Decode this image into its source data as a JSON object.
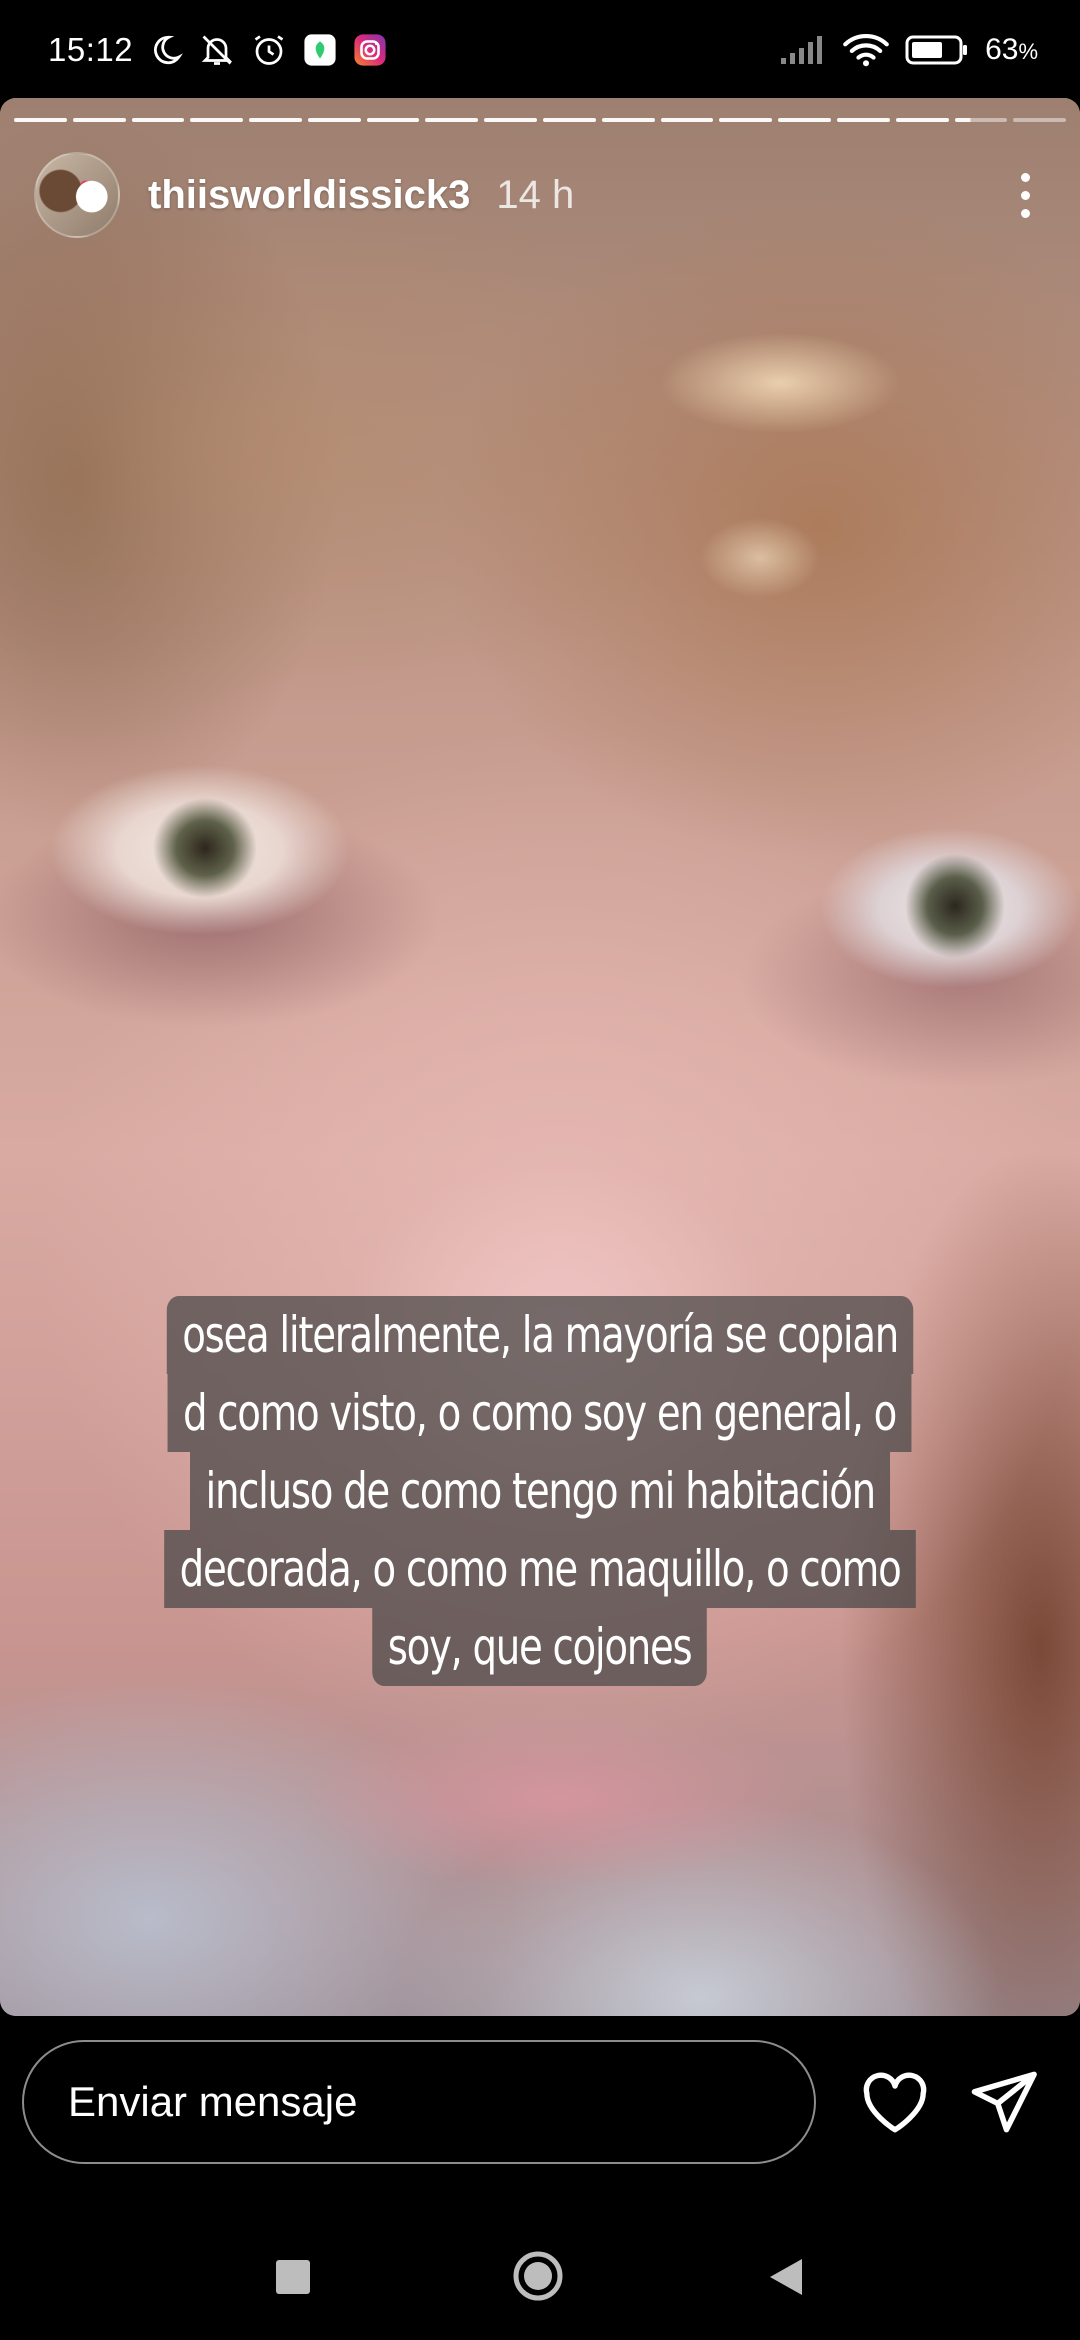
{
  "status_bar": {
    "time": "15:12",
    "battery": "63",
    "battery_unit": "%",
    "icons": [
      "moon-icon",
      "notifications-off-icon",
      "alarm-icon",
      "app-notification-icon",
      "instagram-icon",
      "signal-icon",
      "wifi-icon",
      "battery-icon"
    ]
  },
  "story": {
    "username": "thiisworldissick3",
    "timestamp": "14 h",
    "segments_total": 18,
    "segments_done": 16,
    "caption_lines": [
      "osea literalmente, la mayoría se copian",
      "d como visto, o como soy en general, o",
      "incluso de como tengo mi habitación",
      "decorada, o como me maquillo, o como",
      "soy, que cojones"
    ]
  },
  "reply": {
    "placeholder": "Enviar mensaje"
  },
  "colors": {
    "background": "#000000",
    "caption_bg": "#464646",
    "instagram_gradient": [
      "#f58529",
      "#dd2a7b",
      "#8134af"
    ],
    "app_icon_green": "#2ecc71"
  }
}
